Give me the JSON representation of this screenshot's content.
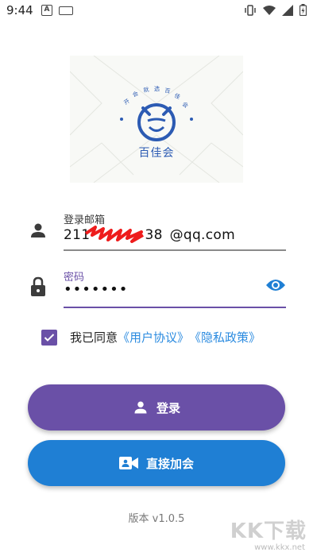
{
  "status_bar": {
    "time": "9:44",
    "left_icons": [
      "notification-a-icon",
      "keyboard-icon"
    ],
    "right_icons": [
      "vibrate-icon",
      "wifi-icon",
      "signal-icon",
      "battery-icon"
    ]
  },
  "logo": {
    "arc_text": "开会就选百佳会",
    "name": "百佳会",
    "accent_color": "#2c5bb3"
  },
  "email_field": {
    "label": "登录邮箱",
    "value": "211    38 @qq.com",
    "icon": "person-icon"
  },
  "password_field": {
    "label": "密码",
    "value": "•••••••",
    "icon": "lock-icon",
    "toggle_icon": "eye-icon"
  },
  "agreement": {
    "checked": true,
    "prefix": "我已同意",
    "user_agreement": "《用户协议》",
    "privacy_policy": "《隐私政策》"
  },
  "buttons": {
    "login_label": "登录",
    "join_label": "直接加会",
    "login_color": "#6a50a7",
    "join_color": "#1f7fd4"
  },
  "version": "版本 v1.0.5",
  "watermark": {
    "text": "KK下载",
    "url": "www.kkx.net"
  }
}
